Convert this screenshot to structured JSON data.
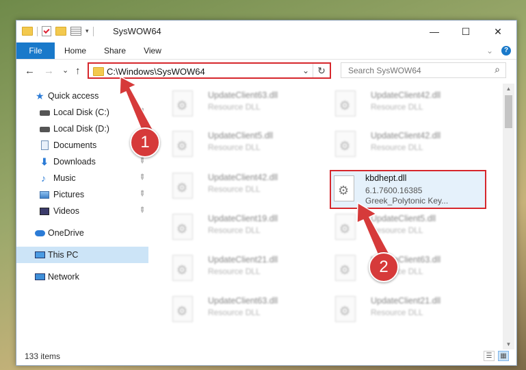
{
  "window": {
    "title": "SysWOW64",
    "minimize": "—",
    "maximize": "☐",
    "close": "✕",
    "quick_access_toolbar": [
      "folder-icon",
      "properties-icon",
      "new-folder-icon",
      "view-icon",
      "customize-arrow"
    ]
  },
  "ribbon": {
    "tabs": [
      "File",
      "Home",
      "Share",
      "View"
    ],
    "expand": "⌄",
    "help": "?"
  },
  "nav": {
    "back": "←",
    "forward": "→",
    "recent": "⌄",
    "up": "↑",
    "address": "C:\\Windows\\SysWOW64",
    "address_dropdown": "⌄",
    "refresh": "↻",
    "search_placeholder": "Search SysWOW64",
    "search_icon": "⌕"
  },
  "sidebar": {
    "items": [
      {
        "label": "Quick access",
        "icon": "star-icon",
        "pinned": false
      },
      {
        "label": "Local Disk (C:)",
        "icon": "drive-icon",
        "pinned": true
      },
      {
        "label": "Local Disk (D:)",
        "icon": "drive-icon",
        "pinned": false
      },
      {
        "label": "Documents",
        "icon": "documents-icon",
        "pinned": true
      },
      {
        "label": "Downloads",
        "icon": "downloads-icon",
        "pinned": true
      },
      {
        "label": "Music",
        "icon": "music-icon",
        "pinned": true
      },
      {
        "label": "Pictures",
        "icon": "pictures-icon",
        "pinned": true
      },
      {
        "label": "Videos",
        "icon": "videos-icon",
        "pinned": true
      },
      {
        "label": "OneDrive",
        "icon": "onedrive-icon",
        "pinned": false
      },
      {
        "label": "This PC",
        "icon": "this-pc-icon",
        "pinned": false,
        "selected": true
      },
      {
        "label": "Network",
        "icon": "network-icon",
        "pinned": false
      }
    ],
    "pin_glyph": "📌"
  },
  "files": {
    "left_column": [
      {
        "name": "UpdateClient63.dll",
        "type": "Resource DLL"
      },
      {
        "name": "UpdateClient5.dll",
        "type": "Resource DLL"
      },
      {
        "name": "UpdateClient42.dll",
        "type": "Resource DLL"
      },
      {
        "name": "UpdateClient19.dll",
        "type": "Resource DLL"
      },
      {
        "name": "UpdateClient21.dll",
        "type": "Resource DLL"
      },
      {
        "name": "UpdateClient63.dll",
        "type": "Resource DLL"
      }
    ],
    "right_column": [
      {
        "name": "UpdateClient42.dll",
        "type": "Resource DLL"
      },
      {
        "name": "UpdateClient42.dll",
        "type": "Resource DLL"
      },
      {
        "name": "UpdateClient5.dll",
        "type": "Resource DLL"
      },
      {
        "name": "UpdateClient63.dll",
        "type": "Resource DLL"
      },
      {
        "name": "UpdateClient21.dll",
        "type": "Resource DLL"
      }
    ],
    "highlighted": {
      "name": "kbdhept.dll",
      "version": "6.1.7600.16385",
      "description": "Greek_Polytonic Key..."
    },
    "gear_glyph": "⚙"
  },
  "status": {
    "item_count": "133 items",
    "details_view": "☰",
    "large_icons_view": "▦"
  },
  "annotations": {
    "step1": "1",
    "step2": "2",
    "color": "#d63a3a"
  }
}
